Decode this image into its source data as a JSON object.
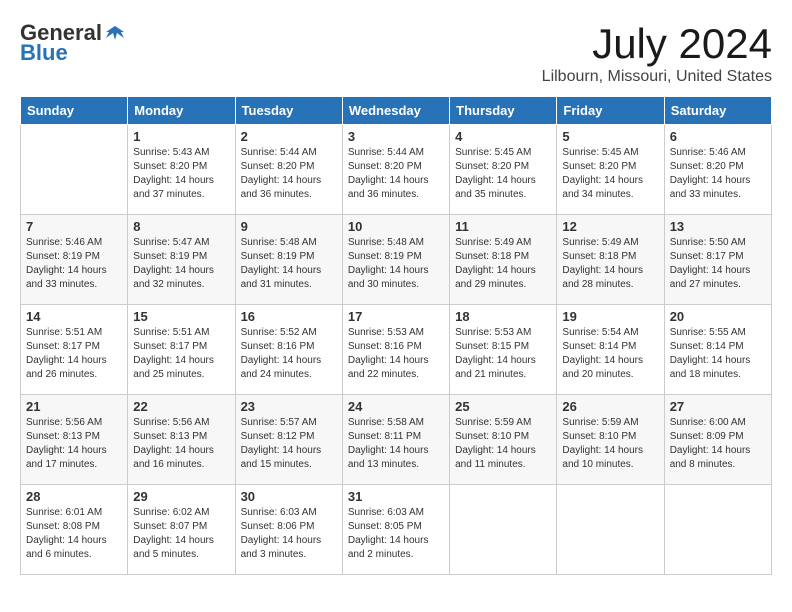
{
  "header": {
    "logo_general": "General",
    "logo_blue": "Blue",
    "month": "July 2024",
    "location": "Lilbourn, Missouri, United States"
  },
  "weekdays": [
    "Sunday",
    "Monday",
    "Tuesday",
    "Wednesday",
    "Thursday",
    "Friday",
    "Saturday"
  ],
  "weeks": [
    [
      {
        "day": "",
        "sunrise": "",
        "sunset": "",
        "daylight": ""
      },
      {
        "day": "1",
        "sunrise": "Sunrise: 5:43 AM",
        "sunset": "Sunset: 8:20 PM",
        "daylight": "Daylight: 14 hours and 37 minutes."
      },
      {
        "day": "2",
        "sunrise": "Sunrise: 5:44 AM",
        "sunset": "Sunset: 8:20 PM",
        "daylight": "Daylight: 14 hours and 36 minutes."
      },
      {
        "day": "3",
        "sunrise": "Sunrise: 5:44 AM",
        "sunset": "Sunset: 8:20 PM",
        "daylight": "Daylight: 14 hours and 36 minutes."
      },
      {
        "day": "4",
        "sunrise": "Sunrise: 5:45 AM",
        "sunset": "Sunset: 8:20 PM",
        "daylight": "Daylight: 14 hours and 35 minutes."
      },
      {
        "day": "5",
        "sunrise": "Sunrise: 5:45 AM",
        "sunset": "Sunset: 8:20 PM",
        "daylight": "Daylight: 14 hours and 34 minutes."
      },
      {
        "day": "6",
        "sunrise": "Sunrise: 5:46 AM",
        "sunset": "Sunset: 8:20 PM",
        "daylight": "Daylight: 14 hours and 33 minutes."
      }
    ],
    [
      {
        "day": "7",
        "sunrise": "Sunrise: 5:46 AM",
        "sunset": "Sunset: 8:19 PM",
        "daylight": "Daylight: 14 hours and 33 minutes."
      },
      {
        "day": "8",
        "sunrise": "Sunrise: 5:47 AM",
        "sunset": "Sunset: 8:19 PM",
        "daylight": "Daylight: 14 hours and 32 minutes."
      },
      {
        "day": "9",
        "sunrise": "Sunrise: 5:48 AM",
        "sunset": "Sunset: 8:19 PM",
        "daylight": "Daylight: 14 hours and 31 minutes."
      },
      {
        "day": "10",
        "sunrise": "Sunrise: 5:48 AM",
        "sunset": "Sunset: 8:19 PM",
        "daylight": "Daylight: 14 hours and 30 minutes."
      },
      {
        "day": "11",
        "sunrise": "Sunrise: 5:49 AM",
        "sunset": "Sunset: 8:18 PM",
        "daylight": "Daylight: 14 hours and 29 minutes."
      },
      {
        "day": "12",
        "sunrise": "Sunrise: 5:49 AM",
        "sunset": "Sunset: 8:18 PM",
        "daylight": "Daylight: 14 hours and 28 minutes."
      },
      {
        "day": "13",
        "sunrise": "Sunrise: 5:50 AM",
        "sunset": "Sunset: 8:17 PM",
        "daylight": "Daylight: 14 hours and 27 minutes."
      }
    ],
    [
      {
        "day": "14",
        "sunrise": "Sunrise: 5:51 AM",
        "sunset": "Sunset: 8:17 PM",
        "daylight": "Daylight: 14 hours and 26 minutes."
      },
      {
        "day": "15",
        "sunrise": "Sunrise: 5:51 AM",
        "sunset": "Sunset: 8:17 PM",
        "daylight": "Daylight: 14 hours and 25 minutes."
      },
      {
        "day": "16",
        "sunrise": "Sunrise: 5:52 AM",
        "sunset": "Sunset: 8:16 PM",
        "daylight": "Daylight: 14 hours and 24 minutes."
      },
      {
        "day": "17",
        "sunrise": "Sunrise: 5:53 AM",
        "sunset": "Sunset: 8:16 PM",
        "daylight": "Daylight: 14 hours and 22 minutes."
      },
      {
        "day": "18",
        "sunrise": "Sunrise: 5:53 AM",
        "sunset": "Sunset: 8:15 PM",
        "daylight": "Daylight: 14 hours and 21 minutes."
      },
      {
        "day": "19",
        "sunrise": "Sunrise: 5:54 AM",
        "sunset": "Sunset: 8:14 PM",
        "daylight": "Daylight: 14 hours and 20 minutes."
      },
      {
        "day": "20",
        "sunrise": "Sunrise: 5:55 AM",
        "sunset": "Sunset: 8:14 PM",
        "daylight": "Daylight: 14 hours and 18 minutes."
      }
    ],
    [
      {
        "day": "21",
        "sunrise": "Sunrise: 5:56 AM",
        "sunset": "Sunset: 8:13 PM",
        "daylight": "Daylight: 14 hours and 17 minutes."
      },
      {
        "day": "22",
        "sunrise": "Sunrise: 5:56 AM",
        "sunset": "Sunset: 8:13 PM",
        "daylight": "Daylight: 14 hours and 16 minutes."
      },
      {
        "day": "23",
        "sunrise": "Sunrise: 5:57 AM",
        "sunset": "Sunset: 8:12 PM",
        "daylight": "Daylight: 14 hours and 15 minutes."
      },
      {
        "day": "24",
        "sunrise": "Sunrise: 5:58 AM",
        "sunset": "Sunset: 8:11 PM",
        "daylight": "Daylight: 14 hours and 13 minutes."
      },
      {
        "day": "25",
        "sunrise": "Sunrise: 5:59 AM",
        "sunset": "Sunset: 8:10 PM",
        "daylight": "Daylight: 14 hours and 11 minutes."
      },
      {
        "day": "26",
        "sunrise": "Sunrise: 5:59 AM",
        "sunset": "Sunset: 8:10 PM",
        "daylight": "Daylight: 14 hours and 10 minutes."
      },
      {
        "day": "27",
        "sunrise": "Sunrise: 6:00 AM",
        "sunset": "Sunset: 8:09 PM",
        "daylight": "Daylight: 14 hours and 8 minutes."
      }
    ],
    [
      {
        "day": "28",
        "sunrise": "Sunrise: 6:01 AM",
        "sunset": "Sunset: 8:08 PM",
        "daylight": "Daylight: 14 hours and 6 minutes."
      },
      {
        "day": "29",
        "sunrise": "Sunrise: 6:02 AM",
        "sunset": "Sunset: 8:07 PM",
        "daylight": "Daylight: 14 hours and 5 minutes."
      },
      {
        "day": "30",
        "sunrise": "Sunrise: 6:03 AM",
        "sunset": "Sunset: 8:06 PM",
        "daylight": "Daylight: 14 hours and 3 minutes."
      },
      {
        "day": "31",
        "sunrise": "Sunrise: 6:03 AM",
        "sunset": "Sunset: 8:05 PM",
        "daylight": "Daylight: 14 hours and 2 minutes."
      },
      {
        "day": "",
        "sunrise": "",
        "sunset": "",
        "daylight": ""
      },
      {
        "day": "",
        "sunrise": "",
        "sunset": "",
        "daylight": ""
      },
      {
        "day": "",
        "sunrise": "",
        "sunset": "",
        "daylight": ""
      }
    ]
  ]
}
